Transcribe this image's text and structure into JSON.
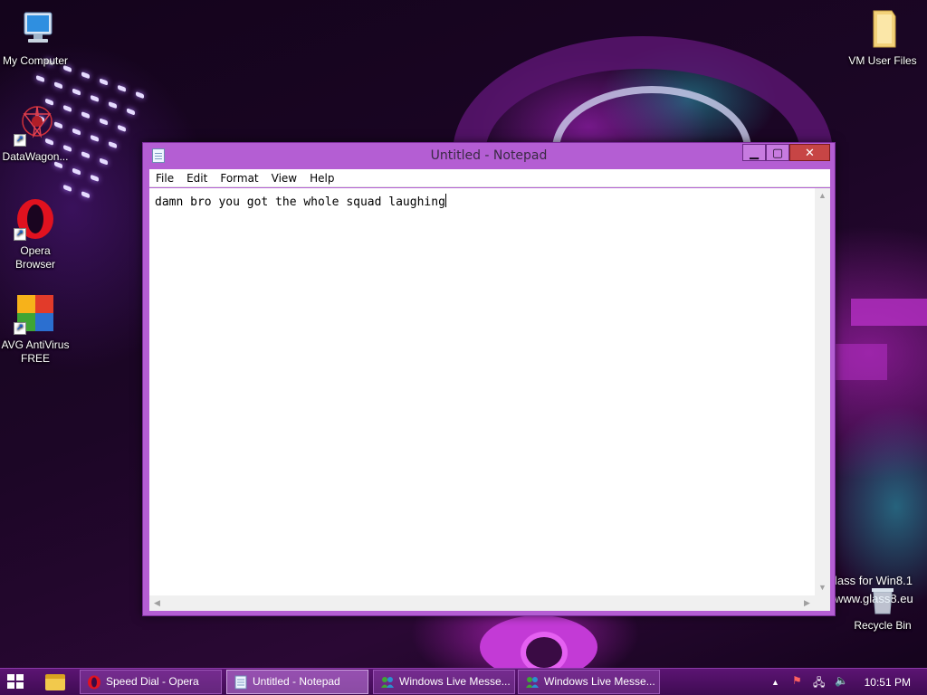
{
  "desktop": {
    "icons": [
      {
        "label": "My Computer"
      },
      {
        "label": "DataWagon..."
      },
      {
        "label": "Opera Browser"
      },
      {
        "label": "AVG AntiVirus FREE"
      },
      {
        "label": "VM User Files"
      },
      {
        "label": "Recycle Bin"
      }
    ],
    "watermark": {
      "line1": "lass for Win8.1",
      "line2": "www.glass8.eu"
    }
  },
  "window": {
    "title": "Untitled - Notepad",
    "controls": {
      "minimize": "▁",
      "maximize": "▢",
      "close": "✕"
    },
    "menu": [
      "File",
      "Edit",
      "Format",
      "View",
      "Help"
    ],
    "content": "damn bro you got the whole squad laughing"
  },
  "taskbar": {
    "tasks": [
      {
        "label": "Speed Dial - Opera",
        "active": false
      },
      {
        "label": "Untitled - Notepad",
        "active": true
      },
      {
        "label": "Windows Live Messe...",
        "active": false
      },
      {
        "label": "Windows Live Messe...",
        "active": false
      }
    ],
    "tray": {
      "chevron": "▲",
      "flag": "⚑",
      "network": "🖧",
      "volume": "🔈"
    },
    "clock": "10:51 PM"
  }
}
